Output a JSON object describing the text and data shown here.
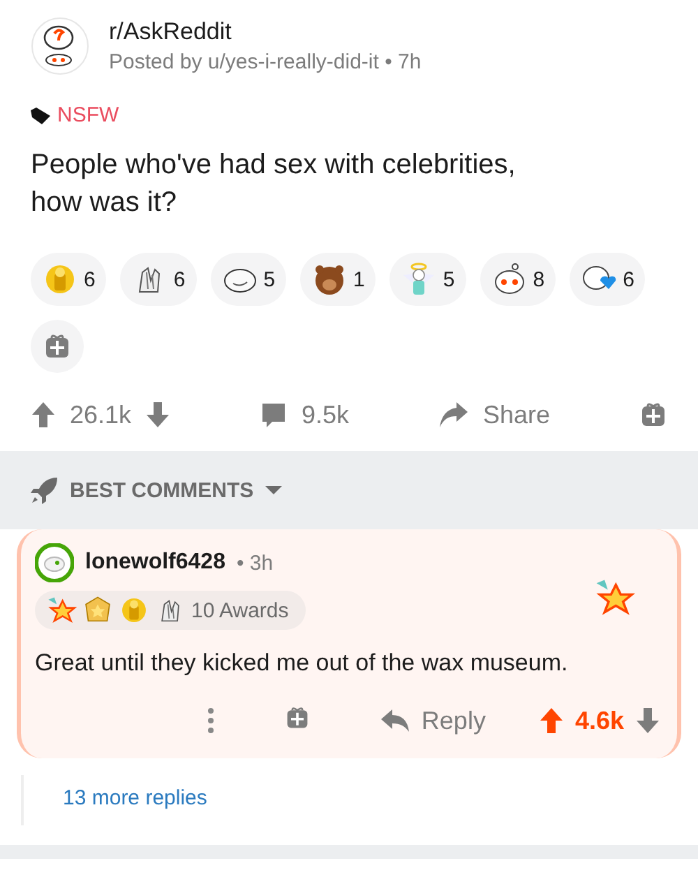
{
  "post": {
    "subreddit": "r/AskReddit",
    "byline": "Posted by u/yes-i-really-did-it • 7h",
    "flair": "NSFW",
    "title": "People who've had sex with celebrities, how was it?",
    "awards": [
      {
        "kind": "gold",
        "count": "6"
      },
      {
        "kind": "clap",
        "count": "6"
      },
      {
        "kind": "moon",
        "count": "5"
      },
      {
        "kind": "bear",
        "count": "1"
      },
      {
        "kind": "angel",
        "count": "5"
      },
      {
        "kind": "snoo",
        "count": "8"
      },
      {
        "kind": "heart",
        "count": "6"
      }
    ],
    "score": "26.1k",
    "comments": "9.5k",
    "share": "Share"
  },
  "sort": {
    "label": "BEST COMMENTS"
  },
  "comment": {
    "author": "lonewolf6428",
    "age": "• 3h",
    "awards": [
      {
        "kind": "star"
      },
      {
        "kind": "medal"
      },
      {
        "kind": "gold"
      },
      {
        "kind": "clap"
      }
    ],
    "awards_label": "10 Awards",
    "body": "Great until they kicked me out of the wax museum.",
    "reply": "Reply",
    "score": "4.6k",
    "upvoted": true,
    "more_replies": "13 more replies"
  }
}
